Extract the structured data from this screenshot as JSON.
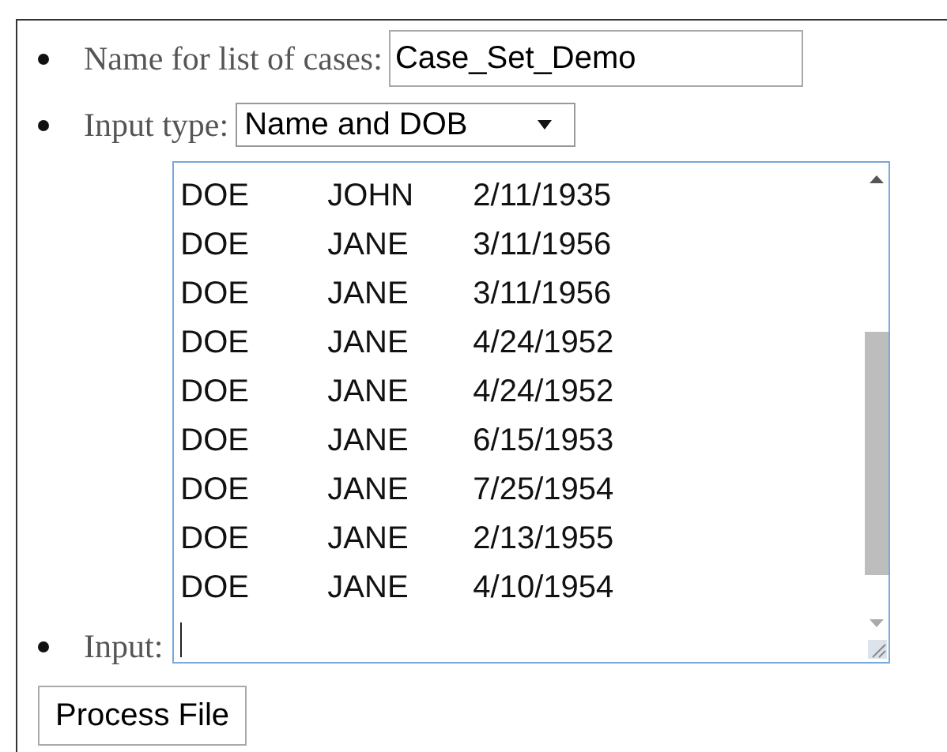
{
  "fields": [
    {
      "kind": "text",
      "label": "Name for list of cases:",
      "value": "Case_Set_Demo"
    },
    {
      "kind": "select",
      "label": "Input type:",
      "value": "Name and DOB"
    },
    {
      "kind": "textarea",
      "label": "Input:",
      "rows": [
        [
          "DOE",
          "JOHN",
          "2/11/1935"
        ],
        [
          "DOE",
          "JANE",
          "3/11/1956"
        ],
        [
          "DOE",
          "JANE",
          "3/11/1956"
        ],
        [
          "DOE",
          "JANE",
          "4/24/1952"
        ],
        [
          "DOE",
          "JANE",
          "4/24/1952"
        ],
        [
          "DOE",
          "JANE",
          "6/15/1953"
        ],
        [
          "DOE",
          "JANE",
          "7/25/1954"
        ],
        [
          "DOE",
          "JANE",
          "2/13/1955"
        ],
        [
          "DOE",
          "JANE",
          "4/10/1954"
        ]
      ]
    }
  ],
  "button": "Process File"
}
